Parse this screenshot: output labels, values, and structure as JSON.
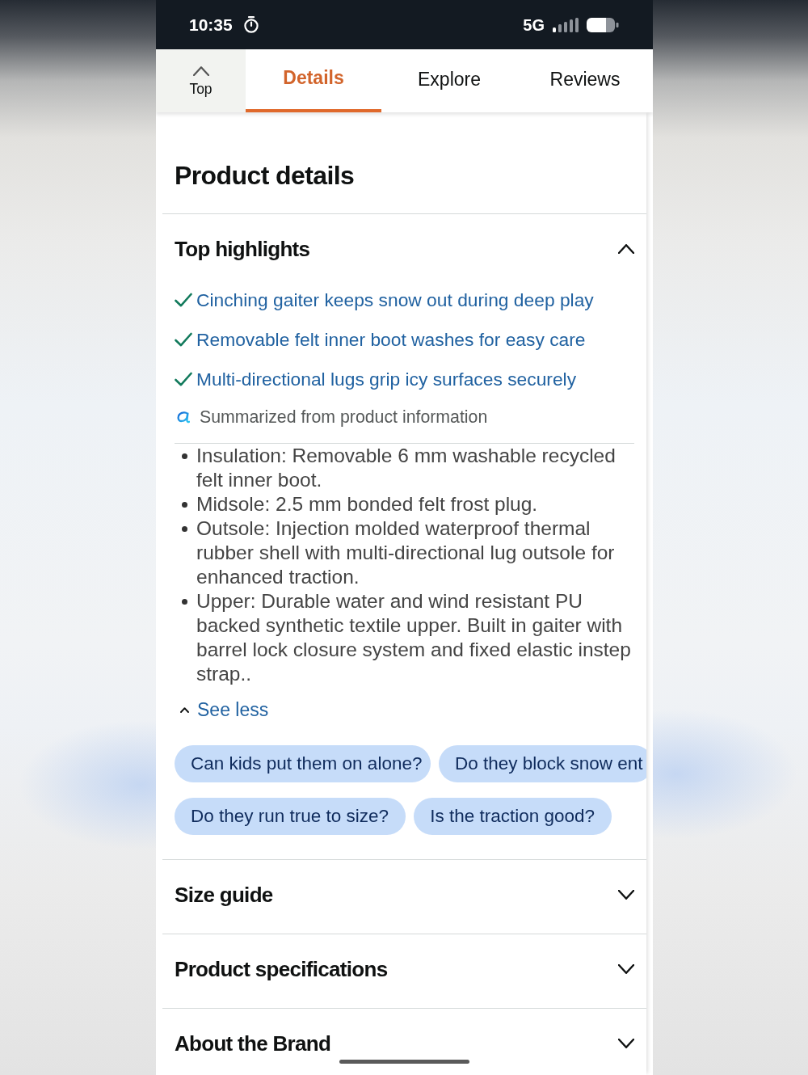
{
  "status_bar": {
    "time": "10:35",
    "network": "5G"
  },
  "tab_bar": {
    "top_button": {
      "label": "Top"
    },
    "tabs": [
      {
        "label": "Details",
        "selected": true
      },
      {
        "label": "Explore",
        "selected": false
      },
      {
        "label": "Reviews",
        "selected": false
      }
    ]
  },
  "page_title": "Product details",
  "sections": [
    {
      "title": "Top highlights",
      "expanded": true,
      "highlights": [
        "Cinching gaiter keeps snow out during deep play",
        "Removable felt inner boot washes for easy care",
        "Multi-directional lugs grip icy surfaces securely"
      ],
      "summary_note": "Summarized from product information",
      "bullets": [
        "Insulation: Removable 6 mm washable recycled felt inner boot.",
        "Midsole: 2.5 mm bonded felt frost plug.",
        "Outsole: Injection molded waterproof thermal rubber shell with multi-directional lug outsole for enhanced traction.",
        "Upper: Durable water and wind resistant PU backed synthetic textile upper. Built in gaiter with barrel lock closure system and fixed elastic instep strap.."
      ],
      "toggle": {
        "label": "See less",
        "expanded": true
      },
      "question_rows": [
        [
          "Can kids put them on alone?",
          "Do they block snow ent"
        ],
        [
          "Do they run true to size?",
          "Is the traction good?"
        ]
      ]
    },
    {
      "title": "Size guide",
      "expanded": false
    },
    {
      "title": "Product specifications",
      "expanded": false
    },
    {
      "title": "About the Brand",
      "expanded": false
    }
  ]
}
